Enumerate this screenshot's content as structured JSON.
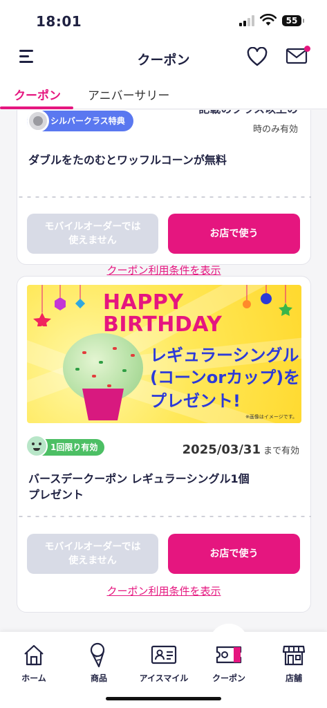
{
  "status_bar": {
    "time": "18:01",
    "battery": "55"
  },
  "header": {
    "title": "クーポン"
  },
  "tabs": [
    {
      "label": "クーポン",
      "active": true
    },
    {
      "label": "アニバーサリー",
      "active": false
    }
  ],
  "coupons": [
    {
      "badge": "シルバークラス特典",
      "partial_condition": "記載のクラス以上の",
      "valid_text": "時のみ有効",
      "title": "ダブルをたのむとワッフルコーンが無料",
      "disabled_button": [
        "モバイルオーダーでは",
        "使えません"
      ],
      "use_button": "お店で使う",
      "terms_link": "クーポン利用条件を表示"
    },
    {
      "banner": {
        "title_line1": "HAPPY",
        "title_line2": "BIRTHDAY",
        "line1": "レギュラーシングル",
        "line2": "(コーンorカップ)を",
        "line3": "プレゼント!",
        "note": "※画像はイメージです。"
      },
      "badge": "1回限り有効",
      "expiry_date": "2025/03/31",
      "expiry_suffix": "まで有効",
      "title": [
        "バースデークーポン レギュラーシングル1個",
        "プレゼント"
      ],
      "disabled_button": [
        "モバイルオーダーでは",
        "使えません"
      ],
      "use_button": "お店で使う",
      "terms_link": "クーポン利用条件を表示"
    }
  ],
  "bottom_nav": [
    {
      "label": "ホーム",
      "icon": "home-icon"
    },
    {
      "label": "商品",
      "icon": "ice-cream-cone-icon"
    },
    {
      "label": "アイスマイル",
      "icon": "member-card-icon"
    },
    {
      "label": "クーポン",
      "icon": "coupon-ticket-icon",
      "active": true
    },
    {
      "label": "店舗",
      "icon": "store-icon"
    }
  ],
  "colors": {
    "accent": "#e5167f",
    "text": "#1f2141",
    "silver_badge": "#5a78f0",
    "once_badge": "#4cbf64",
    "disabled": "#d8dbe6"
  }
}
